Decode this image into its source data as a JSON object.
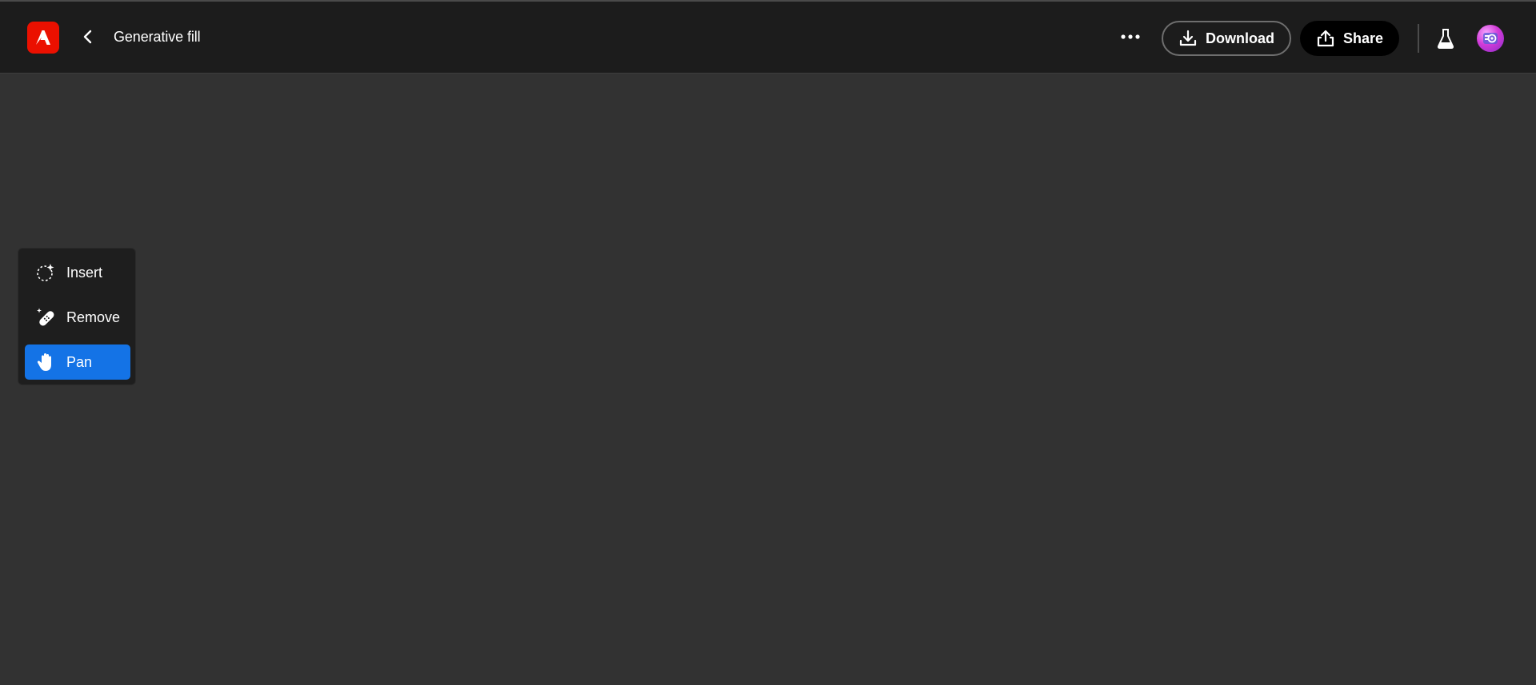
{
  "header": {
    "app_logo": "adobe-express-logo",
    "back_icon": "chevron-left-icon",
    "title": "Generative fill",
    "more_icon": "more-options-icon",
    "download_label": "Download",
    "share_label": "Share",
    "labs_icon": "flask-icon",
    "avatar_icon": "user-avatar"
  },
  "tools": {
    "items": [
      {
        "label": "Insert",
        "icon": "insert-sparkle-icon",
        "active": false
      },
      {
        "label": "Remove",
        "icon": "bandage-eraser-icon",
        "active": false
      },
      {
        "label": "Pan",
        "icon": "hand-icon",
        "active": true
      }
    ]
  },
  "colors": {
    "header_bg": "#1c1c1c",
    "canvas_bg": "#323232",
    "brand_red": "#eb1000",
    "active_blue": "#1473e6"
  }
}
